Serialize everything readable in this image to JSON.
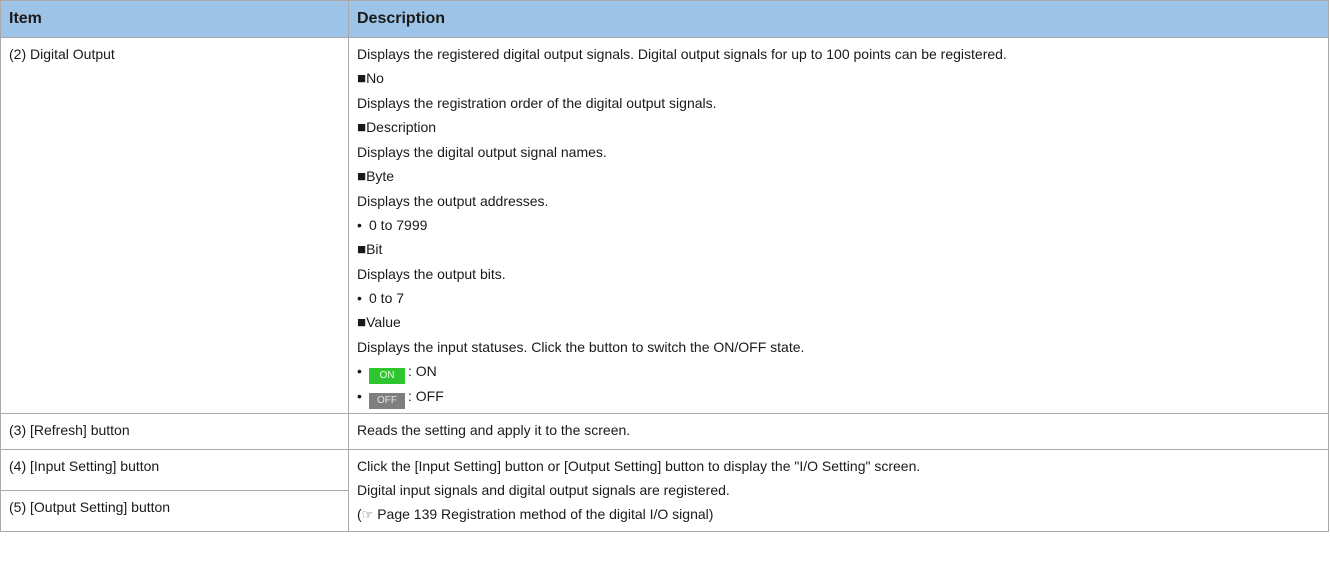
{
  "header": {
    "item": "Item",
    "description": "Description"
  },
  "rows": [
    {
      "item": "(2) Digital Output",
      "intro": "Displays the registered digital output signals. Digital output signals for up to 100 points can be registered.",
      "sections": [
        {
          "title": "No",
          "text": "Displays the registration order of the digital output signals."
        },
        {
          "title": "Description",
          "text": "Displays the digital output signal names."
        },
        {
          "title": "Byte",
          "text": "Displays the output addresses.",
          "bullet": "0 to 7999"
        },
        {
          "title": "Bit",
          "text": "Displays the output bits.",
          "bullet": "0 to 7"
        },
        {
          "title": "Value",
          "text": "Displays the input statuses. Click the button to switch the ON/OFF state."
        }
      ],
      "value_states": [
        {
          "button": "ON",
          "label": ": ON",
          "color": "#2fc52f"
        },
        {
          "button": "OFF",
          "label": ": OFF",
          "color": "#7f7f7f"
        }
      ]
    },
    {
      "item": "(3) [Refresh] button",
      "description": "Reads the setting and apply it to the screen."
    },
    {
      "item": "(4) [Input Setting] button",
      "description": "Click the [Input Setting] button or [Output Setting] button to display the \"I/O Setting\" screen."
    },
    {
      "item": "(5) [Output Setting] button",
      "description": "Digital input signals and digital output signals are registered.",
      "reference": "Page 139 Registration method of the digital I/O signal"
    }
  ],
  "symbols": {
    "square": "■",
    "bullet": "•",
    "reference_icon": "pointing-hand-icon"
  }
}
